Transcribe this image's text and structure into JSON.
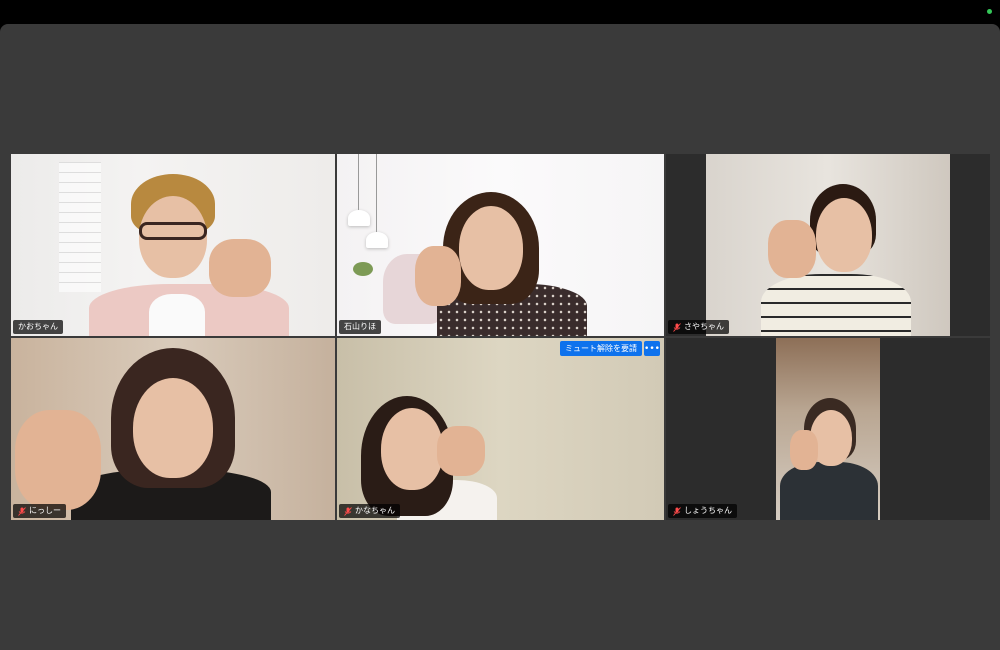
{
  "app": {
    "status_color": "#35c759",
    "active_speaker_color": "#2fa84f",
    "accent": "#0e72ed"
  },
  "participants": [
    {
      "name": "かおちゃん",
      "muted": false,
      "active": false
    },
    {
      "name": "石山りほ",
      "muted": false,
      "active": true
    },
    {
      "name": "さやちゃん",
      "muted": true,
      "active": false
    },
    {
      "name": "にっしー",
      "muted": true,
      "active": false
    },
    {
      "name": "かなちゃん",
      "muted": true,
      "active": false
    },
    {
      "name": "しょうちゃん",
      "muted": true,
      "active": false
    }
  ],
  "controls": {
    "request_unmute_label": "ミュート解除を要請",
    "more_label": "•••"
  },
  "icons": {
    "mic_off": "mic-off-icon",
    "more": "more-options-icon"
  }
}
